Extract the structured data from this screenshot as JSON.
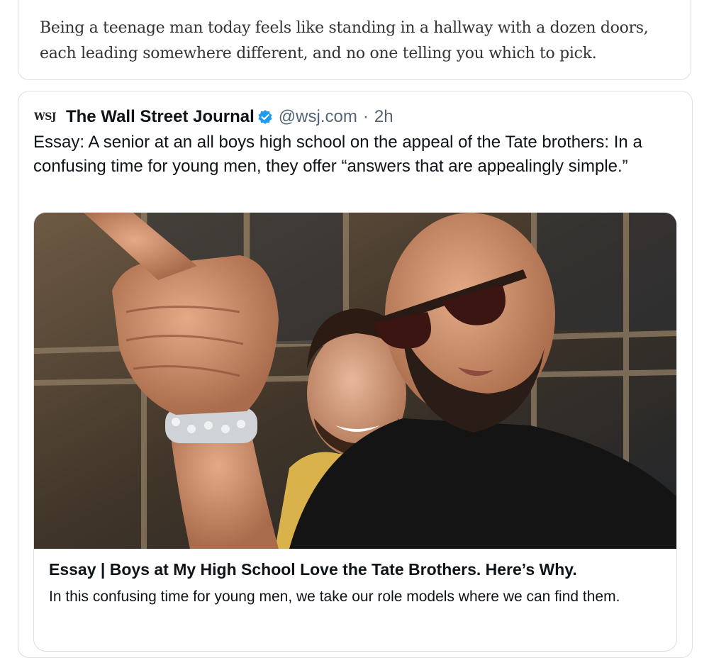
{
  "article_excerpt": {
    "text": "Being a teenage man today feels like standing in a hallway with a dozen doors, each leading somewhere different, and no one telling you which to pick."
  },
  "tweet": {
    "logo_text": "WSJ",
    "account_name": "The Wall Street Journal",
    "verified_icon": "verified-badge-icon",
    "handle": "@wsj.com",
    "separator": "·",
    "time": "2h",
    "text": "Essay: A senior at an all boys high school on the appeal of the Tate brothers: In a confusing time for young men, they offer “answers that are appealingly simple.”"
  },
  "link_card": {
    "title": "Essay | Boys at My High School Love the Tate Brothers. Here’s Why.",
    "description": "In this confusing time for young men, we take our role models where we can find them."
  },
  "colors": {
    "verified": "#1d9bf0",
    "border": "#dcdfe3",
    "secondary_text": "#536471"
  }
}
